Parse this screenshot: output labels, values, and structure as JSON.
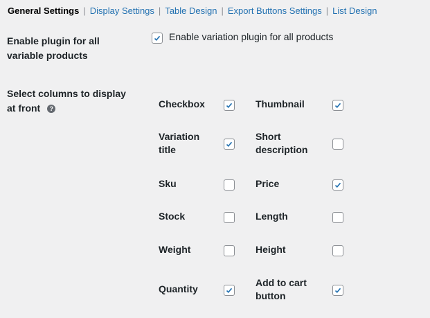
{
  "tabs": [
    {
      "label": "General Settings",
      "active": true
    },
    {
      "label": "Display Settings",
      "active": false
    },
    {
      "label": "Table Design",
      "active": false
    },
    {
      "label": "Export Buttons Settings",
      "active": false
    },
    {
      "label": "List Design",
      "active": false
    }
  ],
  "separator": "|",
  "enable": {
    "label": "Enable plugin for all variable products",
    "option_label": "Enable variation plugin for all products",
    "checked": true
  },
  "columns": {
    "label": "Select columns to display at front",
    "help_icon": "?",
    "items": [
      {
        "label": "Checkbox",
        "checked": true
      },
      {
        "label": "Thumbnail",
        "checked": true
      },
      {
        "label": "Variation title",
        "checked": true
      },
      {
        "label": "Short description",
        "checked": false
      },
      {
        "label": "Sku",
        "checked": false
      },
      {
        "label": "Price",
        "checked": true
      },
      {
        "label": "Stock",
        "checked": false
      },
      {
        "label": "Length",
        "checked": false
      },
      {
        "label": "Weight",
        "checked": false
      },
      {
        "label": "Height",
        "checked": false
      },
      {
        "label": "Quantity",
        "checked": true
      },
      {
        "label": "Add to cart button",
        "checked": true
      }
    ]
  },
  "colors": {
    "accent": "#2271b1"
  }
}
